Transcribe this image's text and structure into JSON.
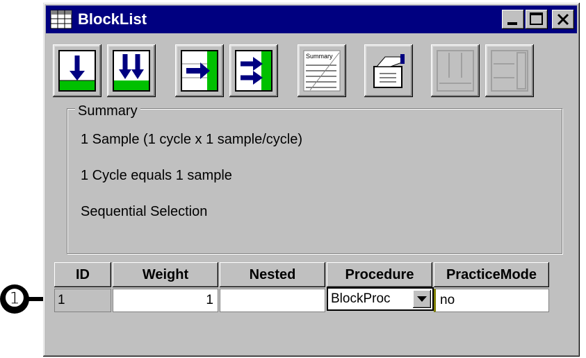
{
  "window": {
    "title": "BlockList",
    "title_bar_color": "#000080"
  },
  "title_controls": [
    "minimize-icon",
    "maximize-icon",
    "close-icon"
  ],
  "toolbar": {
    "buttons": [
      {
        "name": "add-level-button",
        "icon": "insert-row-icon"
      },
      {
        "name": "add-multiple-levels-button",
        "icon": "insert-rows-icon"
      },
      {
        "name": "add-attribute-button",
        "icon": "insert-column-icon"
      },
      {
        "name": "add-multiple-attributes-button",
        "icon": "insert-columns-icon"
      },
      {
        "name": "summary-button",
        "icon": "summary-icon",
        "label": "Summary"
      },
      {
        "name": "properties-button",
        "icon": "properties-icon"
      },
      {
        "name": "remove-levels-button",
        "icon": "remove-rows-icon",
        "disabled": true
      },
      {
        "name": "remove-attributes-button",
        "icon": "remove-columns-icon",
        "disabled": true
      }
    ]
  },
  "summary": {
    "title": "Summary",
    "lines": [
      "1 Sample (1 cycle x 1 sample/cycle)",
      "1 Cycle equals 1 sample",
      "Sequential Selection"
    ]
  },
  "grid": {
    "columns": [
      "ID",
      "Weight",
      "Nested",
      "Procedure",
      "PracticeMode"
    ],
    "row": {
      "id": "1",
      "weight": "1",
      "nested": "",
      "procedure": "BlockProc",
      "practicemode": "no"
    }
  },
  "callout": {
    "label": "➊"
  },
  "colors": {
    "face": "#c0c0c0",
    "icon_green": "#00c000",
    "icon_blue": "#000080"
  }
}
